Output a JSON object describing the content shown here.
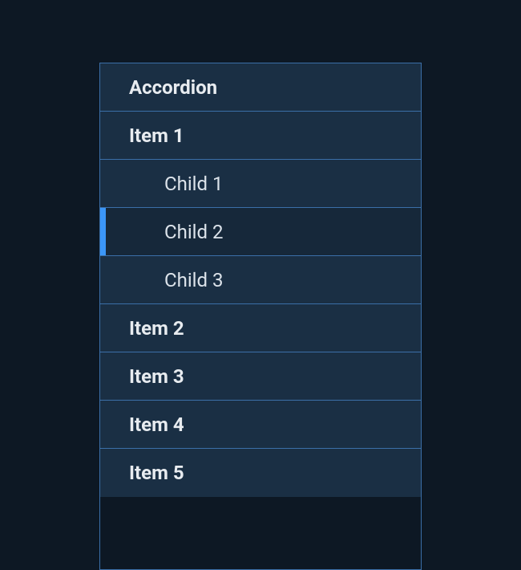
{
  "accordion": {
    "title": "Accordion",
    "items": [
      {
        "label": "Item 1",
        "children": [
          {
            "label": "Child 1",
            "active": false
          },
          {
            "label": "Child 2",
            "active": true
          },
          {
            "label": "Child 3",
            "active": false
          }
        ]
      },
      {
        "label": "Item 2"
      },
      {
        "label": "Item 3"
      },
      {
        "label": "Item 4"
      },
      {
        "label": "Item 5"
      }
    ]
  }
}
